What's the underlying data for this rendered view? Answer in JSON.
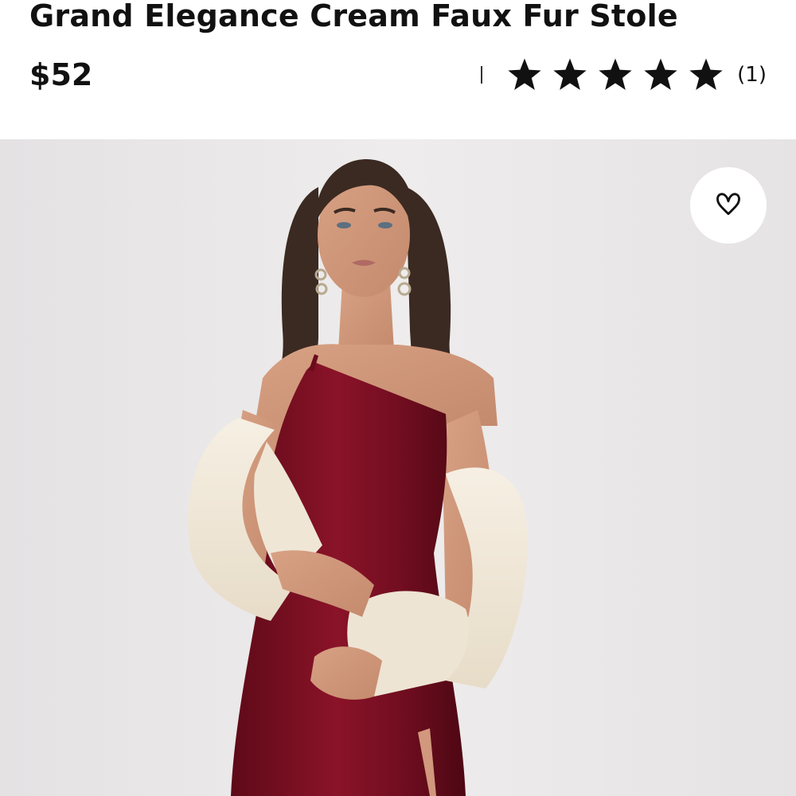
{
  "product": {
    "title": "Grand Elegance Cream Faux Fur Stole",
    "price": "$52",
    "rating": 5,
    "review_count": "(1)"
  },
  "icons": {
    "favorite": "heart-outline-icon",
    "star": "star-filled-icon"
  },
  "colors": {
    "text": "#111111",
    "hero_background": "#e9e7e8",
    "dress": "#7d0f22",
    "stole": "#f3eadc"
  }
}
